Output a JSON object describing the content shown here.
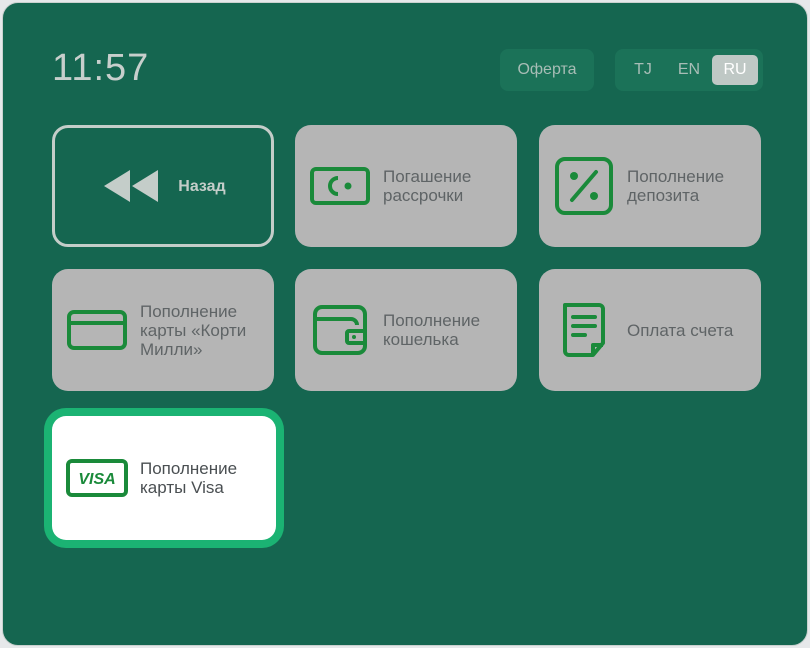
{
  "header": {
    "clock": "11:57",
    "offer_label": "Оферта",
    "languages": [
      "TJ",
      "EN",
      "RU"
    ],
    "active_language": "RU"
  },
  "tiles": {
    "back": "Назад",
    "installment": "Погашение рассрочки",
    "deposit": "Пополнение депозита",
    "korti_milli": "Пополнение карты «Корти Милли»",
    "wallet": "Пополнение кошелька",
    "bill": "Оплата счета",
    "visa": "Пополнение карты Visa",
    "visa_logo": "VISA"
  },
  "colors": {
    "background": "#156650",
    "tile": "#b5b5b5",
    "icon_green": "#1a8a3a",
    "highlight": "#1bb373"
  }
}
